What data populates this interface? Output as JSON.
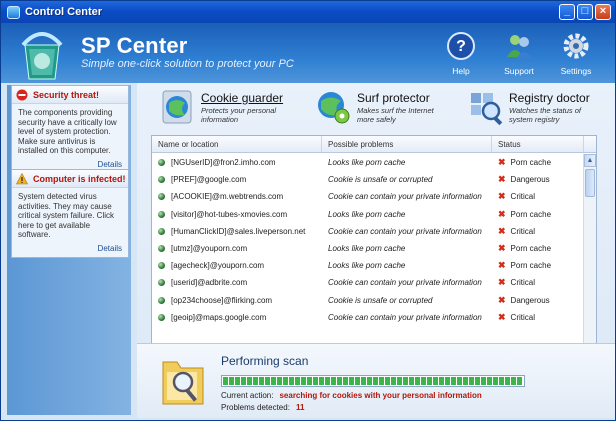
{
  "window": {
    "title": "Control Center"
  },
  "header": {
    "brand": "SP Center",
    "tagline": "Simple one-click solution to protect your PC",
    "buttons": [
      {
        "label": "Help",
        "icon": "help-icon"
      },
      {
        "label": "Support",
        "icon": "support-icon"
      },
      {
        "label": "Settings",
        "icon": "settings-icon"
      }
    ]
  },
  "sidebar": {
    "alerts": [
      {
        "title": "Security threat!",
        "icon": "no-entry-icon",
        "body": "The components providing security have a critically low level of system protection. Make sure antivirus is installed on this computer.",
        "link": "Details"
      },
      {
        "title": "Computer is infected!",
        "icon": "warning-icon",
        "body": "System detected virus activities. They may cause critical system failure. Click here to get available software.",
        "link": "Details"
      }
    ]
  },
  "tabs": [
    {
      "title": "Cookie guarder",
      "subtitle": "Protects your personal information",
      "icon": "globe-shield-icon",
      "active": true
    },
    {
      "title": "Surf protector",
      "subtitle": "Makes surf the Internet more safely",
      "icon": "globe-gear-icon",
      "active": false
    },
    {
      "title": "Registry doctor",
      "subtitle": "Watches the status of system registry",
      "icon": "registry-magnifier-icon",
      "active": false
    }
  ],
  "grid": {
    "columns": [
      "Name or location",
      "Possible problems",
      "Status"
    ],
    "rows": [
      {
        "name": "[NGUserID]@fron2.imho.com",
        "problem": "Looks like porn cache",
        "status": "Porn cache"
      },
      {
        "name": "[PREF]@google.com",
        "problem": "Cookie is unsafe or corrupted",
        "status": "Dangerous"
      },
      {
        "name": "[ACOOKIE]@m.webtrends.com",
        "problem": "Cookie can contain your private information",
        "status": "Critical"
      },
      {
        "name": "[visitor]@hot-tubes-xmovies.com",
        "problem": "Looks like porn cache",
        "status": "Porn cache"
      },
      {
        "name": "[HumanClickID]@sales.liveperson.net",
        "problem": "Cookie can contain your private information",
        "status": "Critical"
      },
      {
        "name": "[utmz]@youporn.com",
        "problem": "Looks like porn cache",
        "status": "Porn cache"
      },
      {
        "name": "[agecheck]@youporn.com",
        "problem": "Looks like porn cache",
        "status": "Porn cache"
      },
      {
        "name": "[userid]@adbrite.com",
        "problem": "Cookie can contain your private information",
        "status": "Critical"
      },
      {
        "name": "[op234choose]@flirking.com",
        "problem": "Cookie is unsafe or corrupted",
        "status": "Dangerous"
      },
      {
        "name": "[geoip]@maps.google.com",
        "problem": "Cookie can contain your private information",
        "status": "Critical"
      }
    ]
  },
  "scan": {
    "title": "Performing scan",
    "progress": 1.0,
    "current_action_label": "Current action:",
    "current_action": "searching for cookies with your personal information",
    "problems_label": "Problems detected:",
    "problems_count": "11"
  },
  "colors": {
    "accent": "#1b5fb8",
    "alert_red": "#b3160c",
    "ok_green": "#3bb54a"
  }
}
